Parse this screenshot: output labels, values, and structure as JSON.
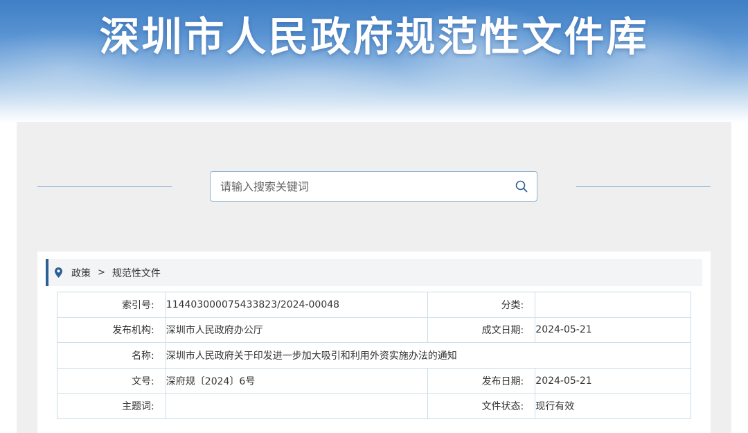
{
  "banner": {
    "title": "深圳市人民政府规范性文件库"
  },
  "search": {
    "placeholder": "请输入搜索关键词",
    "icon": "search-icon"
  },
  "breadcrumb": {
    "icon": "location-pin-icon",
    "items": [
      "政策",
      "规范性文件"
    ],
    "separator": ">"
  },
  "info": {
    "index_label": "索引号:",
    "index_value": "11440300007543382 3/2024-00048",
    "category_label": "分类:",
    "category_value": "",
    "publisher_label": "发布机构:",
    "publisher_value": "深圳市人民政府办公厅",
    "created_label": "成文日期:",
    "created_value": "2024-05-21",
    "name_label": "名称:",
    "name_value": "深圳市人民政府关于印发进一步加大吸引和利用外资实施办法的通知",
    "doc_no_label": "文号:",
    "doc_no_value": "深府规〔2024〕6号",
    "published_label": "发布日期:",
    "published_value": "2024-05-21",
    "subject_label": "主题词:",
    "subject_value": "",
    "status_label": "文件状态:",
    "status_value": "现行有效"
  },
  "colors": {
    "accent": "#2c5f94",
    "border": "#c9dde6",
    "search_border": "#8db1d6",
    "panel_bg": "#efefef"
  }
}
